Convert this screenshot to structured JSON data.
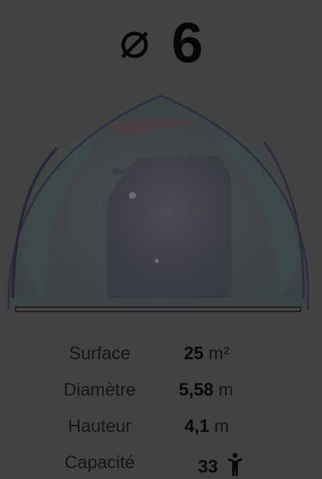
{
  "header": {
    "diameter_icon": "diameter-symbol-icon",
    "size": "6"
  },
  "dome_image": {
    "description_icon": "geodesic-dome-icon"
  },
  "specs": [
    {
      "label": "Surface",
      "value": "25",
      "unit": "m²"
    },
    {
      "label": "Diamètre",
      "value": "5,58",
      "unit": "m"
    },
    {
      "label": "Hauteur",
      "value": "4,1",
      "unit": "m"
    },
    {
      "label": "Capacité",
      "value": "33",
      "unit_icon": "person-icon"
    }
  ],
  "colors": {
    "background": "#424242",
    "text": "#151515"
  }
}
